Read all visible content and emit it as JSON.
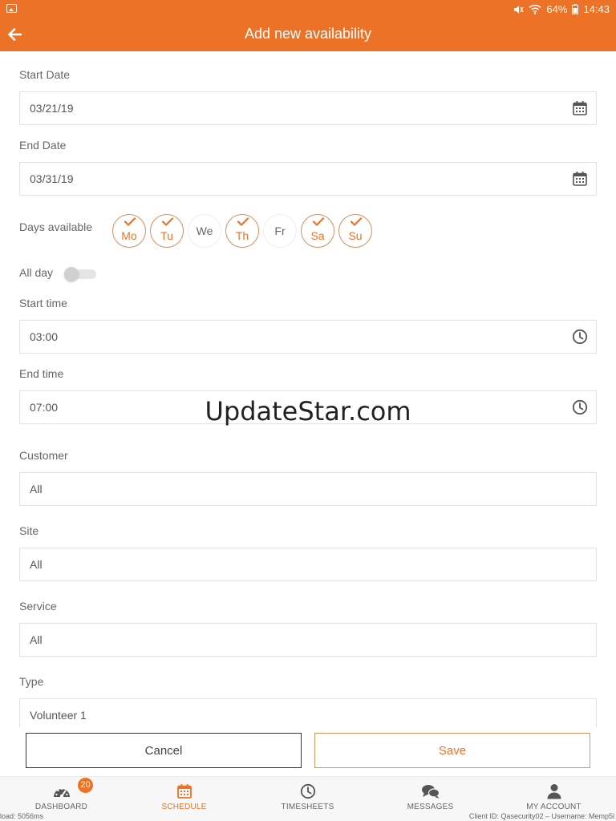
{
  "status": {
    "battery": "64%",
    "time": "14:43"
  },
  "header": {
    "title": "Add new availability"
  },
  "form": {
    "start_date": {
      "label": "Start Date",
      "value": "03/21/19"
    },
    "end_date": {
      "label": "End Date",
      "value": "03/31/19"
    },
    "days_label": "Days available",
    "days": [
      {
        "label": "Mo",
        "checked": true
      },
      {
        "label": "Tu",
        "checked": true
      },
      {
        "label": "We",
        "checked": false
      },
      {
        "label": "Th",
        "checked": true
      },
      {
        "label": "Fr",
        "checked": false
      },
      {
        "label": "Sa",
        "checked": true
      },
      {
        "label": "Su",
        "checked": true
      }
    ],
    "all_day": {
      "label": "All day",
      "on": false
    },
    "start_time": {
      "label": "Start time",
      "value": "03:00"
    },
    "end_time": {
      "label": "End time",
      "value": "07:00"
    },
    "customer": {
      "label": "Customer",
      "value": "All"
    },
    "site": {
      "label": "Site",
      "value": "All"
    },
    "service": {
      "label": "Service",
      "value": "All"
    },
    "type": {
      "label": "Type",
      "value": "Volunteer 1"
    }
  },
  "watermark": "UpdateStar.com",
  "actions": {
    "cancel": "Cancel",
    "save": "Save"
  },
  "nav": {
    "items": [
      {
        "label": "DASHBOARD",
        "badge": "20"
      },
      {
        "label": "SCHEDULE"
      },
      {
        "label": "TIMESHEETS"
      },
      {
        "label": "MESSAGES"
      },
      {
        "label": "MY ACCOUNT"
      }
    ],
    "active": "SCHEDULE"
  },
  "footer": {
    "left": "load: 5056ms",
    "right": "Client ID: Qasecurity02 – Username: Memp5l"
  },
  "colors": {
    "accent": "#ec7227",
    "accent_border": "#d5965e"
  }
}
